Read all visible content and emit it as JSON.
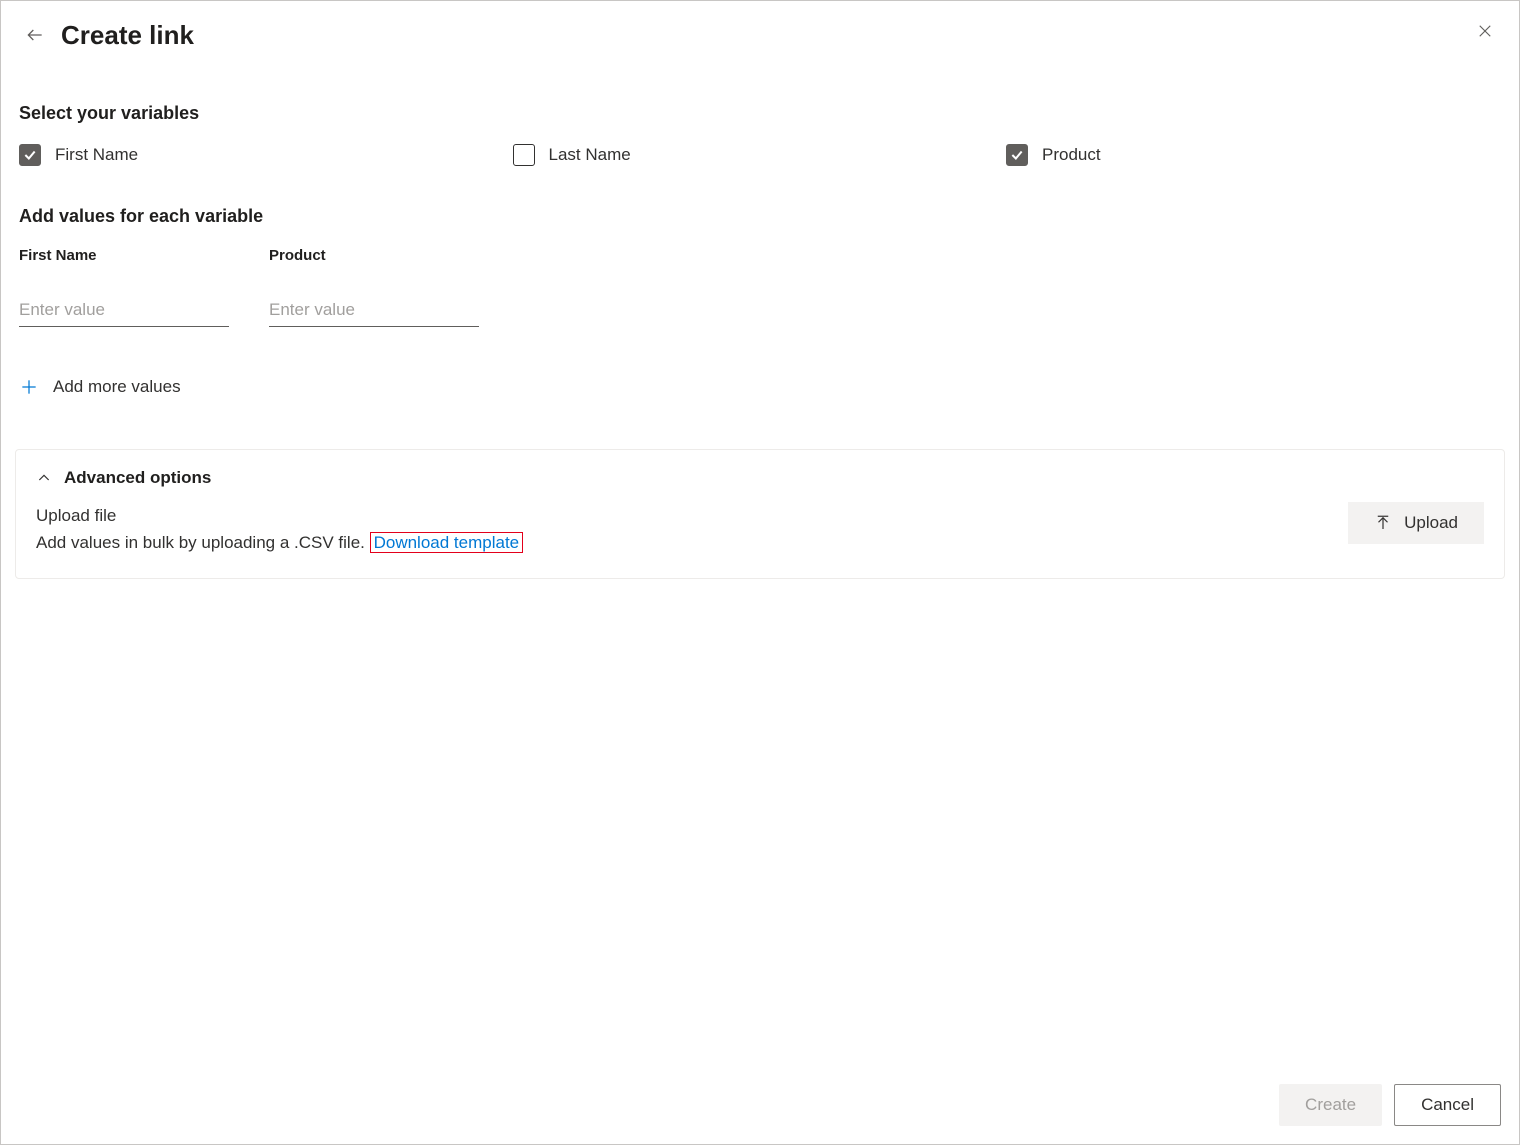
{
  "header": {
    "title": "Create link"
  },
  "variables_section": {
    "title": "Select your variables",
    "items": [
      {
        "label": "First Name",
        "checked": true
      },
      {
        "label": "Last Name",
        "checked": false
      },
      {
        "label": "Product",
        "checked": true
      }
    ]
  },
  "values_section": {
    "title": "Add values for each variable",
    "columns": [
      {
        "label": "First Name",
        "placeholder": "Enter value"
      },
      {
        "label": "Product",
        "placeholder": "Enter value"
      }
    ],
    "add_more_label": "Add more values"
  },
  "advanced": {
    "title": "Advanced options",
    "upload_title": "Upload file",
    "upload_desc": "Add values in bulk by uploading a .CSV file. ",
    "download_link": "Download template",
    "upload_button": "Upload"
  },
  "footer": {
    "create": "Create",
    "cancel": "Cancel"
  }
}
